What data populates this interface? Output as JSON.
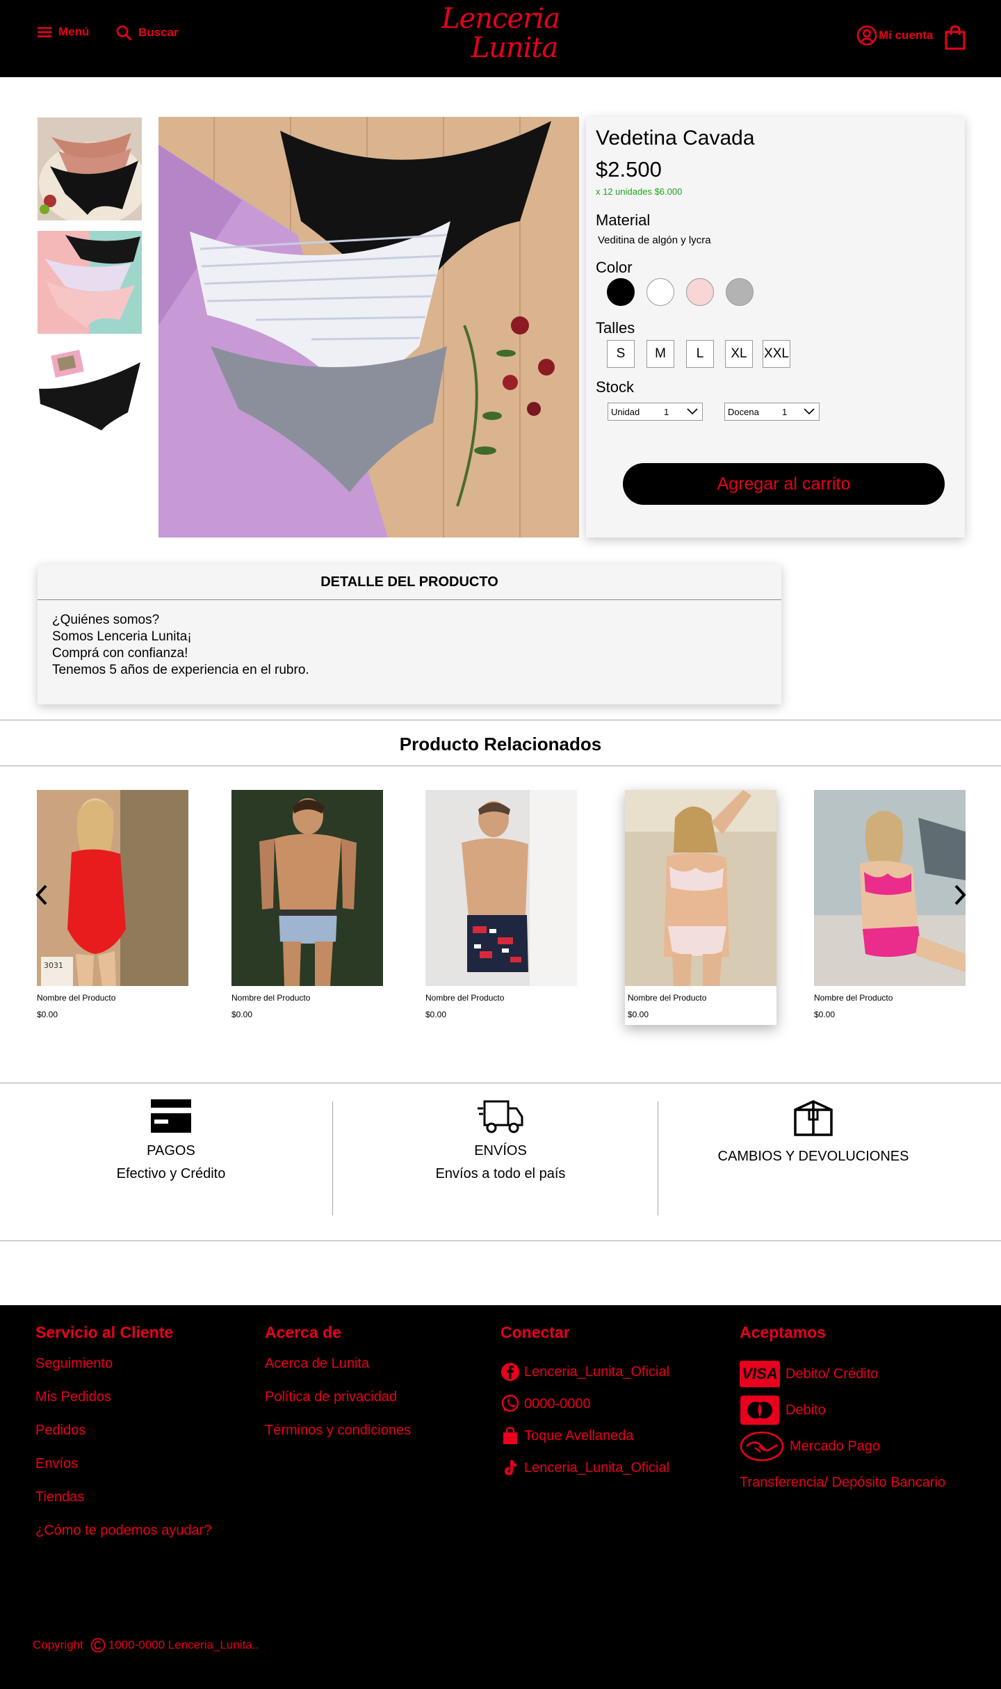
{
  "header": {
    "menu_label": "Menú",
    "search_label": "Buscar",
    "logo_line1": "Lenceria",
    "logo_line2": "Lunita",
    "account_label": "Mi cuenta"
  },
  "product": {
    "title": "Vedetina Cavada",
    "price": "$2.500",
    "bulk_price": "x 12 unidades $6.000",
    "material_label": "Material",
    "material_value": "Veditina de algón y lycra",
    "color_label": "Color",
    "colors": [
      "#000000",
      "#ffffff",
      "#f8d6d6",
      "#b3b3b3"
    ],
    "sizes_label": "Talles",
    "sizes": [
      "S",
      "M",
      "L",
      "XL",
      "XXL"
    ],
    "stock_label": "Stock",
    "stock_unit_label": "Unidad",
    "stock_unit_qty": "1",
    "stock_dozen_label": "Docena",
    "stock_dozen_qty": "1",
    "add_to_cart_label": "Agregar al carrito"
  },
  "detail": {
    "heading": "DETALLE DEL PRODUCTO",
    "lines": [
      "¿Quiénes somos?",
      "Somos Lenceria Lunita¡",
      "Comprá con confianza!",
      "Tenemos 5 años de experiencia en el rubro."
    ]
  },
  "related": {
    "title": "Producto Relacionados",
    "items": [
      {
        "name": "Nombre del Producto",
        "price": "$0.00",
        "tag": "3031"
      },
      {
        "name": "Nombre del Producto",
        "price": "$0.00"
      },
      {
        "name": "Nombre del Producto",
        "price": "$0.00"
      },
      {
        "name": "Nombre del Producto",
        "price": "$0.00"
      },
      {
        "name": "Nombre del Producto",
        "price": "$0.00"
      }
    ]
  },
  "features": [
    {
      "title": "PAGOS",
      "subtitle": "Efectivo y Crédito"
    },
    {
      "title": "ENVÍOS",
      "subtitle": "Envíos a todo el país"
    },
    {
      "title": "CAMBIOS Y DEVOLUCIONES",
      "subtitle": ""
    }
  ],
  "footer": {
    "service": {
      "heading": "Servicio al Cliente",
      "links": [
        "Seguimiento",
        "Mis Pedidos",
        "Pedidos",
        "Envíos",
        "Tiendas",
        "¿Cómo te podemos ayudar?"
      ]
    },
    "about": {
      "heading": "Acerca de",
      "links": [
        "Acerca de Lunita",
        "Política de privacidad",
        "Términos y condiciones"
      ]
    },
    "connect": {
      "heading": "Conectar",
      "facebook": "Lenceria_Lunita_Oficial",
      "whatsapp": "0000-0000",
      "store": "Toque Avellaneda",
      "tiktok": "Lenceria_Lunita_Oficial"
    },
    "accept": {
      "heading": "Aceptamos",
      "visa_logo": "VISA",
      "visa_label": "Debito/ Crédito",
      "mastercard_label": "Debito",
      "mercadopago_label": "Mercado Pago",
      "transfer_label": "Transferencia/ Depósito Bancario"
    },
    "copyright_prefix": "Copyright",
    "copyright_text": "1000-0000 Lenceria_Lunita.."
  },
  "colors": {
    "accent": "#e8001d",
    "header_bg": "#000000",
    "panel_bg": "#f5f5f5",
    "bulk_price": "#1aa61a"
  }
}
